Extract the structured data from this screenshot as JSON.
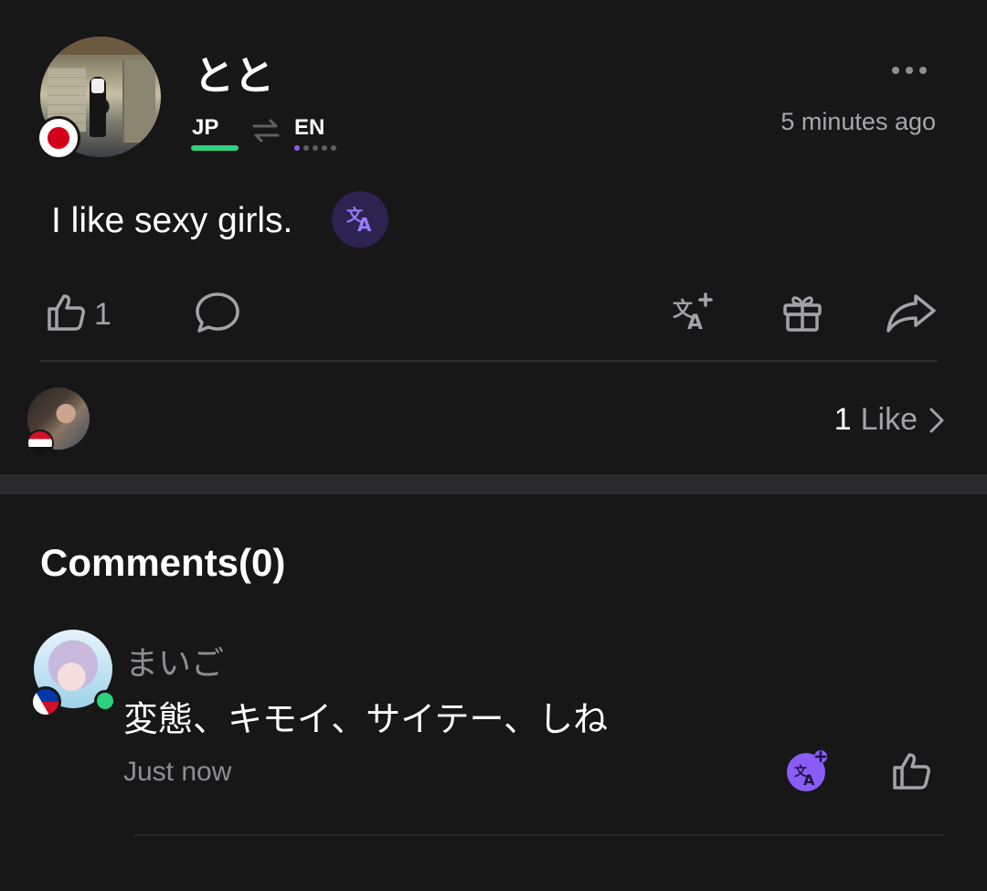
{
  "post": {
    "author_name": "とと",
    "native_language": "JP",
    "learning_language": "EN",
    "time_ago": "5 minutes ago",
    "text": "I like sexy girls.",
    "like_count": "1"
  },
  "likes_summary": {
    "count": "1",
    "label": "Like"
  },
  "comments": {
    "title": "Comments(0)",
    "items": [
      {
        "author": "まいご",
        "text": "変態、キモイ、サイテー、しね",
        "time": "Just now"
      }
    ]
  },
  "colors": {
    "background": "#171718",
    "accent_green": "#2bd17e",
    "accent_purple": "#8a5cf6",
    "muted_text": "#a7a7ab"
  },
  "icons": [
    "more-icon",
    "swap-icon",
    "translate-icon",
    "like-icon",
    "comment-icon",
    "gift-icon",
    "share-icon",
    "chevron-right-icon"
  ]
}
